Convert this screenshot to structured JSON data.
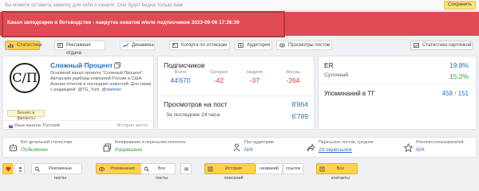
{
  "note_bar": {
    "text": "Вы можете оставить заметку для себя о канале. Она будет видна только вам",
    "save_label": "Сохранить"
  },
  "alert": {
    "text": "Канал заподозрен в ботоводстве - накрутка охватов и/или подписчиков 2023-09-06 17:26:39"
  },
  "tabs": [
    {
      "label": "Статистика",
      "icon": "stats-icon"
    },
    {
      "label": "Рекламная отдача",
      "icon": "ads-icon"
    },
    {
      "label": "Динамика",
      "icon": "chart-icon"
    },
    {
      "label": "Когорта по отпискам",
      "icon": "cohort-icon"
    },
    {
      "label": "Аудитория",
      "icon": "audience-icon"
    },
    {
      "label": "Просмотры постов",
      "icon": "eye-icon"
    }
  ],
  "chart_picture_button": "Статистика картинкой",
  "profile": {
    "avatar_text": "С/П",
    "name": "Сложный Процент",
    "description_1": "Основной канал проекта \"Сложный Процент\". Авторские разборы компаний России и США. Анализ отчетов и последних новостей. Для связи с редакцией: @TG_Yurii, @",
    "description_link": "stalmen",
    "category": "Бизнес и финансы",
    "language": "Язык канала: Русский",
    "history_link": "История места"
  },
  "subscribers": {
    "title": "Подписчиков",
    "columns": [
      {
        "label": "Всего",
        "value": "44'670",
        "color": "blue"
      },
      {
        "label": "Сегодня",
        "value": "-42",
        "color": "red"
      },
      {
        "label": "Неделя",
        "value": "-37",
        "color": "red"
      },
      {
        "label": "Месяц",
        "value": "-264",
        "color": "red"
      }
    ],
    "views_title": "Просмотров на пост",
    "views_value": "8'864",
    "views_sub_label": "За последние 24 часа",
    "views_sub_value": "6'789"
  },
  "er": {
    "er_label": "ER",
    "er_value": "19.8%",
    "daily_label": "Суточный",
    "daily_value": "15.2%",
    "mentions_label": "Упоминаний в ТГ",
    "mentions_a": "458",
    "mentions_sep": " / ",
    "mentions_b": "151"
  },
  "info_row": [
    {
      "label": "Бот детальной статистики",
      "value": "Подключен",
      "color": "green",
      "icon": "bot-icon"
    },
    {
      "label": "Копирование и пересылка контента",
      "value": "Разрешено",
      "color": "green",
      "icon": "copy-icon"
    },
    {
      "label": "Пол аудитории",
      "value": "N/A",
      "color": "blue",
      "icon": "gender-icon"
    },
    {
      "label": "Пересылок постов, среднее",
      "value": "19 пересылок",
      "color": "blue",
      "icon": "share-icon"
    },
    {
      "label": "Premium-пользователей",
      "value": "N/A",
      "color": "blue",
      "icon": "premium-icon"
    }
  ],
  "bottom_bar": {
    "ads_posts": "Рекламные посты",
    "mentions": "Упоминания",
    "all_posts": "Все посты",
    "history": "История описаний",
    "names": "названий",
    "links": "ссылок",
    "all_contacts": "Все контакты"
  },
  "colors": {
    "accent": "#ffd24d",
    "alert": "#e04b56",
    "link": "#2a6ebd",
    "negative": "#d33a3a",
    "positive": "#2d9a45"
  }
}
